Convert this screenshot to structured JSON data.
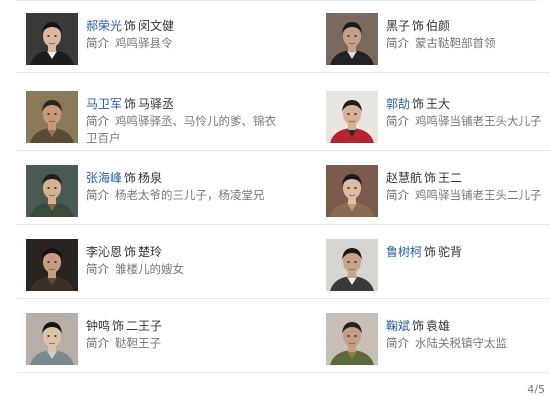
{
  "desc_label": "简介",
  "role_sep": "饰",
  "cast": [
    {
      "actor": "郝荣光",
      "role": "闵文健",
      "desc": "鸡鸣驿县令",
      "linked": true,
      "photo": {
        "bg": "#3c3a38",
        "skin": "#d9b8a0",
        "hair": "#141414",
        "cloth": "#1d1d1d",
        "collar": "#f2f2f2"
      }
    },
    {
      "actor": "黑子",
      "role": "伯颜",
      "desc": "蒙古鞑靼部首领",
      "linked": false,
      "photo": {
        "bg": "#7a6a5e",
        "skin": "#c7a08a",
        "hair": "#1b1b1b",
        "cloth": "#222222",
        "collar": "#dcdcdc"
      }
    },
    {
      "actor": "马卫军",
      "role": "马驿丞",
      "desc": "鸡鸣驿驿丞、马怜儿的爹、锦衣卫百户",
      "linked": true,
      "photo": {
        "bg": "#8a7a5a",
        "skin": "#c99a76",
        "hair": "#2a2520",
        "cloth": "#5a4a35",
        "collar": "#8a7a60"
      }
    },
    {
      "actor": "郭劼",
      "role": "王大",
      "desc": "鸡鸣驿当铺老王头大儿子",
      "linked": true,
      "photo": {
        "bg": "#e8e4e0",
        "skin": "#d8b195",
        "hair": "#1e1e1e",
        "cloth": "#b8232d",
        "collar": "#2a2a2a"
      }
    },
    {
      "actor": "张海峰",
      "role": "杨泉",
      "desc": "杨老太爷的三儿子，杨凌堂兄",
      "linked": true,
      "photo": {
        "bg": "#4a5a55",
        "skin": "#d6b090",
        "hair": "#202020",
        "cloth": "#3b4a3a",
        "collar": "#7a6a50"
      }
    },
    {
      "actor": "赵慧航",
      "role": "王二",
      "desc": "鸡鸣驿当铺老王头二儿子",
      "linked": false,
      "photo": {
        "bg": "#7a5a4a",
        "skin": "#dcbca4",
        "hair": "#1c1c1c",
        "cloth": "#8a6a55",
        "collar": "#c0a080"
      }
    },
    {
      "actor": "李沁恩",
      "role": "楚玲",
      "desc": "雏楼儿的嫂女",
      "linked": false,
      "photo": {
        "bg": "#2a2420",
        "skin": "#c89a80",
        "hair": "#161210",
        "cloth": "#3a3028",
        "collar": "#5a4a40"
      }
    },
    {
      "actor": "鲁树柯",
      "role": "驼背",
      "desc": "",
      "linked": true,
      "photo": {
        "bg": "#d8d4d0",
        "skin": "#c8a48a",
        "hair": "#1a1a1a",
        "cloth": "#3a3a3a",
        "collar": "#eeeeee"
      }
    },
    {
      "actor": "钟鸣",
      "role": "二王子",
      "desc": "鞑靼王子",
      "linked": false,
      "photo": {
        "bg": "#b8b0a8",
        "skin": "#dfc2aa",
        "hair": "#141414",
        "cloth": "#7a8a8a",
        "collar": "#d0d0d0"
      }
    },
    {
      "actor": "鞠斌",
      "role": "袁雄",
      "desc": "水陆关税镇守太监",
      "linked": true,
      "photo": {
        "bg": "#c8c0b8",
        "skin": "#c89e82",
        "hair": "#222222",
        "cloth": "#5a6a3a",
        "collar": "#8a7a50"
      }
    }
  ],
  "pager": "4/5"
}
